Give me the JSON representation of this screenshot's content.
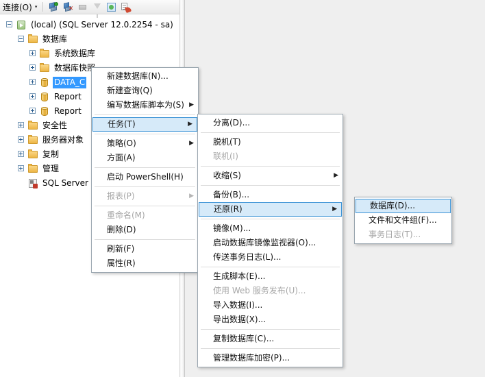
{
  "toolbar": {
    "connect_label": "连接(O)",
    "caret": "▾",
    "buttons": [
      {
        "name": "connect-object-explorer-icon",
        "title": "连接"
      },
      {
        "name": "disconnect-object-explorer-icon",
        "title": "断开连接"
      },
      {
        "name": "stop-icon",
        "title": "停止"
      },
      {
        "name": "filter-icon",
        "title": "筛选器"
      },
      {
        "name": "refresh-icon",
        "title": "刷新"
      },
      {
        "name": "script-icon",
        "title": "脚本"
      }
    ]
  },
  "tree": {
    "nodes": [
      {
        "label": "(local) (SQL Server 12.0.2254 - sa)",
        "icon": "server-icon",
        "level": 0,
        "expander": "minus",
        "selected": false
      },
      {
        "label": "数据库",
        "icon": "folder-icon",
        "level": 1,
        "expander": "minus",
        "selected": false
      },
      {
        "label": "系统数据库",
        "icon": "folder-icon",
        "level": 2,
        "expander": "plus",
        "selected": false
      },
      {
        "label": "数据库快照",
        "icon": "folder-icon",
        "level": 2,
        "expander": "plus",
        "selected": false
      },
      {
        "label": "DATA_C",
        "icon": "database-icon",
        "level": 2,
        "expander": "plus",
        "selected": true
      },
      {
        "label": "Report",
        "icon": "database-icon",
        "level": 2,
        "expander": "plus",
        "selected": false
      },
      {
        "label": "Report",
        "icon": "database-icon",
        "level": 2,
        "expander": "plus",
        "selected": false
      },
      {
        "label": "安全性",
        "icon": "folder-icon",
        "level": 1,
        "expander": "plus",
        "selected": false
      },
      {
        "label": "服务器对象",
        "icon": "folder-icon",
        "level": 1,
        "expander": "plus",
        "selected": false
      },
      {
        "label": "复制",
        "icon": "folder-icon",
        "level": 1,
        "expander": "plus",
        "selected": false
      },
      {
        "label": "管理",
        "icon": "folder-icon",
        "level": 1,
        "expander": "plus",
        "selected": false
      },
      {
        "label": "SQL Server",
        "icon": "sql-agent-icon",
        "level": 1,
        "expander": "none",
        "selected": false
      }
    ]
  },
  "menu1": {
    "items": [
      {
        "label": "新建数据库(N)...",
        "submenu": false,
        "disabled": false,
        "highlighted": false,
        "separator_after": false
      },
      {
        "label": "新建查询(Q)",
        "submenu": false,
        "disabled": false,
        "highlighted": false,
        "separator_after": false
      },
      {
        "label": "编写数据库脚本为(S)",
        "submenu": true,
        "disabled": false,
        "highlighted": false,
        "separator_after": true
      },
      {
        "label": "任务(T)",
        "submenu": true,
        "disabled": false,
        "highlighted": true,
        "separator_after": true
      },
      {
        "label": "策略(O)",
        "submenu": true,
        "disabled": false,
        "highlighted": false,
        "separator_after": false
      },
      {
        "label": "方面(A)",
        "submenu": false,
        "disabled": false,
        "highlighted": false,
        "separator_after": true
      },
      {
        "label": "启动 PowerShell(H)",
        "submenu": false,
        "disabled": false,
        "highlighted": false,
        "separator_after": true
      },
      {
        "label": "报表(P)",
        "submenu": true,
        "disabled": true,
        "highlighted": false,
        "separator_after": true
      },
      {
        "label": "重命名(M)",
        "submenu": false,
        "disabled": true,
        "highlighted": false,
        "separator_after": false
      },
      {
        "label": "删除(D)",
        "submenu": false,
        "disabled": false,
        "highlighted": false,
        "separator_after": true
      },
      {
        "label": "刷新(F)",
        "submenu": false,
        "disabled": false,
        "highlighted": false,
        "separator_after": false
      },
      {
        "label": "属性(R)",
        "submenu": false,
        "disabled": false,
        "highlighted": false,
        "separator_after": false
      }
    ]
  },
  "menu2": {
    "items": [
      {
        "label": "分离(D)...",
        "submenu": false,
        "disabled": false,
        "highlighted": false,
        "separator_after": true
      },
      {
        "label": "脱机(T)",
        "submenu": false,
        "disabled": false,
        "highlighted": false,
        "separator_after": false
      },
      {
        "label": "联机(I)",
        "submenu": false,
        "disabled": true,
        "highlighted": false,
        "separator_after": true
      },
      {
        "label": "收缩(S)",
        "submenu": true,
        "disabled": false,
        "highlighted": false,
        "separator_after": true
      },
      {
        "label": "备份(B)...",
        "submenu": false,
        "disabled": false,
        "highlighted": false,
        "separator_after": false
      },
      {
        "label": "还原(R)",
        "submenu": true,
        "disabled": false,
        "highlighted": true,
        "separator_after": true
      },
      {
        "label": "镜像(M)...",
        "submenu": false,
        "disabled": false,
        "highlighted": false,
        "separator_after": false
      },
      {
        "label": "启动数据库镜像监视器(O)...",
        "submenu": false,
        "disabled": false,
        "highlighted": false,
        "separator_after": false
      },
      {
        "label": "传送事务日志(L)...",
        "submenu": false,
        "disabled": false,
        "highlighted": false,
        "separator_after": true
      },
      {
        "label": "生成脚本(E)...",
        "submenu": false,
        "disabled": false,
        "highlighted": false,
        "separator_after": false
      },
      {
        "label": "使用 Web 服务发布(U)...",
        "submenu": false,
        "disabled": true,
        "highlighted": false,
        "separator_after": false
      },
      {
        "label": "导入数据(I)...",
        "submenu": false,
        "disabled": false,
        "highlighted": false,
        "separator_after": false
      },
      {
        "label": "导出数据(X)...",
        "submenu": false,
        "disabled": false,
        "highlighted": false,
        "separator_after": true
      },
      {
        "label": "复制数据库(C)...",
        "submenu": false,
        "disabled": false,
        "highlighted": false,
        "separator_after": true
      },
      {
        "label": "管理数据库加密(P)...",
        "submenu": false,
        "disabled": false,
        "highlighted": false,
        "separator_after": false
      }
    ]
  },
  "menu3": {
    "items": [
      {
        "label": "数据库(D)...",
        "submenu": false,
        "disabled": false,
        "highlighted": true,
        "separator_after": false
      },
      {
        "label": "文件和文件组(F)...",
        "submenu": false,
        "disabled": false,
        "highlighted": false,
        "separator_after": false
      },
      {
        "label": "事务日志(T)...",
        "submenu": false,
        "disabled": true,
        "highlighted": false,
        "separator_after": false
      }
    ]
  },
  "colors": {
    "selection_blue": "#3399ff",
    "menu_highlight_fill": "#d6eaf9",
    "menu_highlight_border": "#3c93d6",
    "panel_background": "#efefef",
    "disabled_text": "#a7a7a7"
  }
}
